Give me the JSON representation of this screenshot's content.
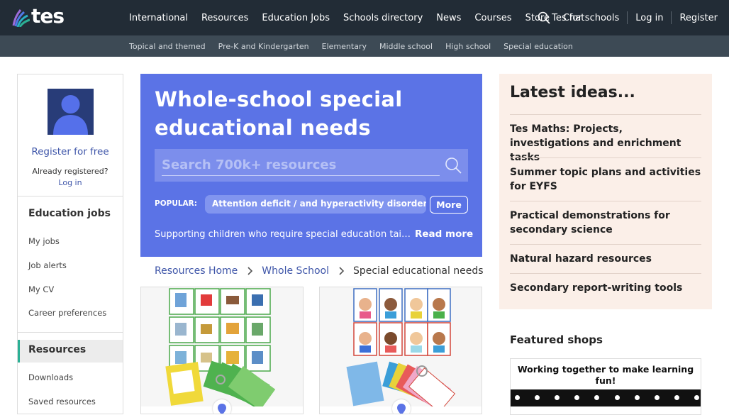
{
  "brand": {
    "logo_text": "tes"
  },
  "nav": {
    "items": [
      "International",
      "Resources",
      "Education Jobs",
      "Schools directory",
      "News",
      "Courses",
      "Store",
      "Chat"
    ],
    "tes_for_schools": "Tes for schools",
    "login": "Log in",
    "register": "Register"
  },
  "subnav": {
    "items": [
      "Topical and themed",
      "Pre-K and Kindergarten",
      "Elementary",
      "Middle school",
      "High school",
      "Special education"
    ]
  },
  "sidebar": {
    "register_free": "Register for free",
    "already_registered": "Already registered?",
    "login": "Log in",
    "jobs_heading": "Education jobs",
    "jobs_items": [
      "My jobs",
      "Job alerts",
      "My CV",
      "Career preferences"
    ],
    "resources_heading": "Resources",
    "resources_items": [
      "Downloads",
      "Saved resources"
    ]
  },
  "hero": {
    "title": "Whole-school special educational needs resources",
    "search_placeholder": "Search 700k+ resources",
    "popular_label": "POPULAR:",
    "popular_chip": "Attention deficit / and hyperactivity disorder (...",
    "more_button": "More",
    "description": "Supporting children who require special education tailored to their individual needs",
    "read_more": "Read more"
  },
  "breadcrumb": {
    "home": "Resources Home",
    "level2": "Whole School",
    "current": "Special educational needs"
  },
  "latest_ideas": {
    "title": "Latest ideas...",
    "items": [
      "Tes Maths: Projects, investigations and enrichment tasks",
      "Summer topic plans and activities for EYFS",
      "Practical demonstrations for secondary science",
      "Natural hazard resources",
      "Secondary report-writing tools"
    ]
  },
  "featured": {
    "title": "Featured shops",
    "shop_banner": "Working together to make learning fun!"
  },
  "colors": {
    "topbar": "#222c36",
    "subbar": "#3d4a55",
    "hero": "#5b73e6",
    "ideas_bg": "#fbefe8",
    "link": "#3f56a9",
    "accent": "#2bb095"
  }
}
